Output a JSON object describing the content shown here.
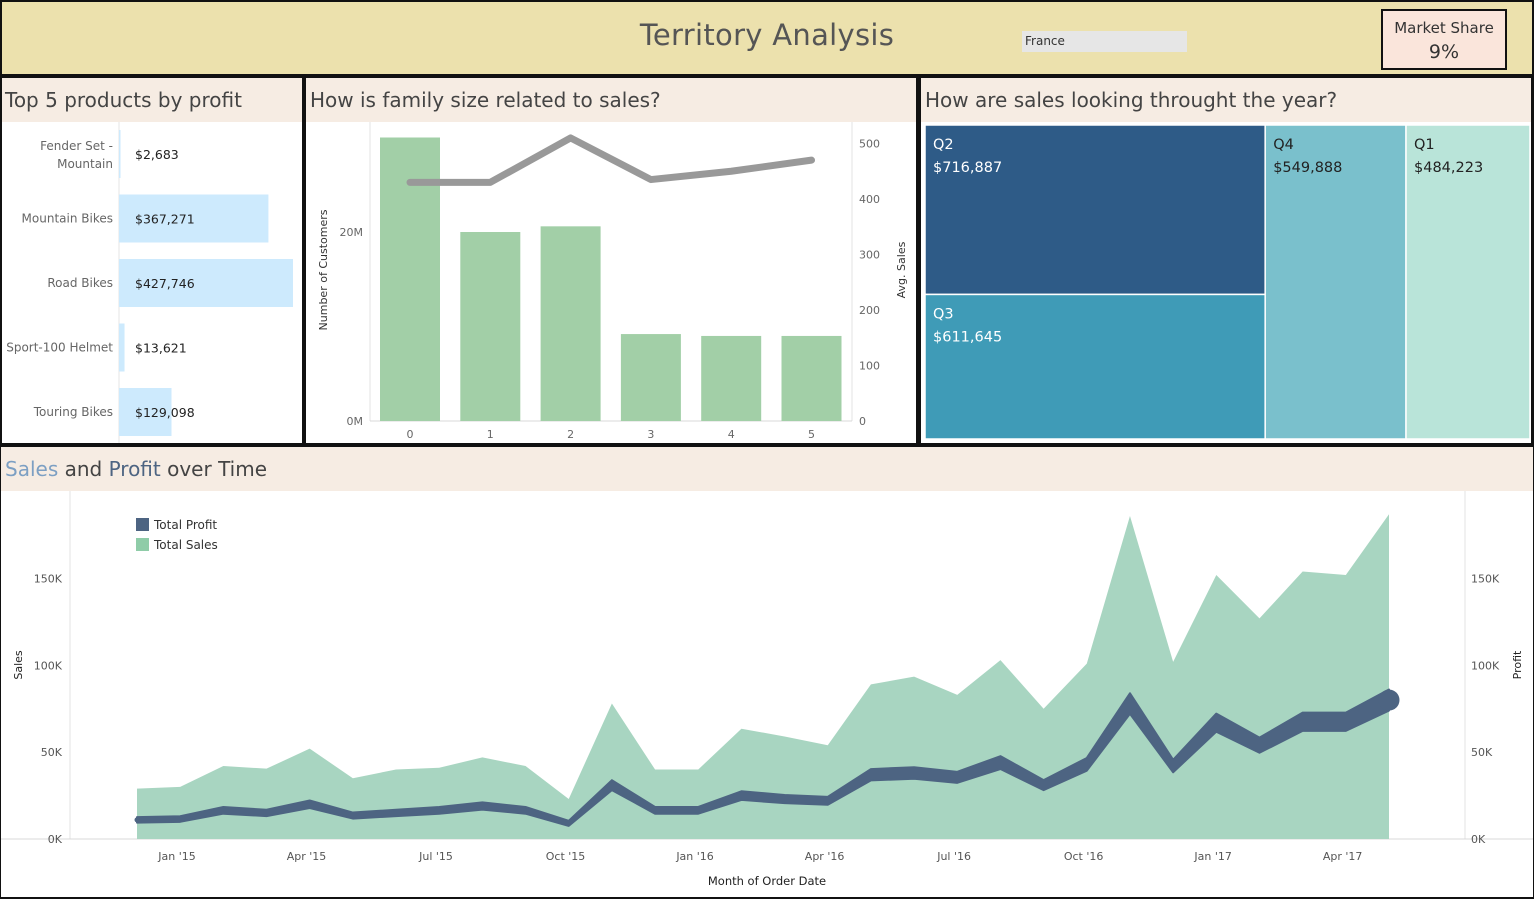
{
  "header": {
    "title": "Territory Analysis",
    "filter_value": "France",
    "market_share_label": "Market Share",
    "market_share_value": "9%"
  },
  "colors": {
    "header_bg": "#ece1ad",
    "panel_title_bg": "#f6ece3",
    "market_card_bg": "#fae5db",
    "bar_light_blue": "#cdeafd",
    "bar_green": "#a2cfa7",
    "line_gray": "#999999",
    "area_green": "#a8d5c1",
    "profit_navy": "#4d6482",
    "sales_word": "#7c9fc3",
    "q2": "#2e5b87",
    "q3": "#3f9bb7",
    "q4": "#7ac0cc",
    "q1": "#b9e4d9"
  },
  "chart_data": [
    {
      "id": "top5",
      "type": "bar",
      "orientation": "horizontal",
      "title": "Top 5 products by profit",
      "categories": [
        "Fender Set - Mountain",
        "Mountain Bikes",
        "Road Bikes",
        "Sport-100 Helmet",
        "Touring Bikes"
      ],
      "category_lines": [
        [
          "Fender Set -",
          "Mountain"
        ],
        [
          "Mountain Bikes"
        ],
        [
          "Road Bikes"
        ],
        [
          "Sport-100 Helmet"
        ],
        [
          "Touring Bikes"
        ]
      ],
      "values": [
        2683,
        367271,
        427746,
        13621,
        129098
      ],
      "labels": [
        "$2,683",
        "$367,271",
        "$427,746",
        "$13,621",
        "$129,098"
      ],
      "xlim": [
        0,
        440000
      ]
    },
    {
      "id": "family",
      "type": "bar",
      "title": "How is family size related to sales?",
      "categories": [
        "0",
        "1",
        "2",
        "3",
        "4",
        "5"
      ],
      "series": [
        {
          "name": "Number of Customers",
          "type": "bar",
          "values": [
            30000000,
            20000000,
            20600000,
            9200000,
            9000000,
            9000000
          ]
        },
        {
          "name": "Avg. Sales",
          "type": "line",
          "values": [
            430,
            430,
            510,
            435,
            450,
            470
          ]
        }
      ],
      "ylabel": "Number of Customers",
      "y2label": "Avg. Sales",
      "yticks": [
        {
          "v": 0,
          "l": "0M"
        },
        {
          "v": 20000000,
          "l": "20M"
        }
      ],
      "y2ticks": [
        {
          "v": 0,
          "l": "0"
        },
        {
          "v": 100,
          "l": "100"
        },
        {
          "v": 200,
          "l": "200"
        },
        {
          "v": 300,
          "l": "300"
        },
        {
          "v": 400,
          "l": "400"
        },
        {
          "v": 500,
          "l": "500"
        }
      ],
      "ylim": [
        0,
        31500000
      ],
      "y2lim": [
        0,
        545
      ]
    },
    {
      "id": "quarters",
      "type": "treemap",
      "title": "How are sales looking throught the year?",
      "items": [
        {
          "name": "Q2",
          "label": "$716,887",
          "value": 716887
        },
        {
          "name": "Q3",
          "label": "$611,645",
          "value": 611645
        },
        {
          "name": "Q4",
          "label": "$549,888",
          "value": 549888
        },
        {
          "name": "Q1",
          "label": "$484,223",
          "value": 484223
        }
      ]
    },
    {
      "id": "timeline",
      "type": "area",
      "title_parts": [
        "Sales",
        " and ",
        "Profit",
        " over Time"
      ],
      "xlabel": "Month of Order Date",
      "ylabel": "Sales",
      "y2label": "Profit",
      "x": [
        "Jan '15",
        "Feb '15",
        "Mar '15",
        "Apr '15",
        "May '15",
        "Jun '15",
        "Jul '15",
        "Aug '15",
        "Sep '15",
        "Oct '15",
        "Nov '15",
        "Dec '15",
        "Jan '16",
        "Feb '16",
        "Mar '16",
        "Apr '16",
        "May '16",
        "Jun '16",
        "Jul '16",
        "Aug '16",
        "Sep '16",
        "Oct '16",
        "Nov '16",
        "Dec '16",
        "Jan '17",
        "Feb '17",
        "Mar '17",
        "Apr '17",
        "May '17",
        "Jun '17"
      ],
      "xticks": [
        "Jan '15",
        "Apr '15",
        "Jul '15",
        "Oct '15",
        "Jan '16",
        "Apr '16",
        "Jul '16",
        "Oct '16",
        "Jan '17",
        "Apr '17"
      ],
      "series": [
        {
          "name": "Total Sales",
          "type": "area",
          "values": [
            29000,
            30000,
            42000,
            40500,
            52000,
            35000,
            40000,
            41000,
            47000,
            42000,
            23000,
            78000,
            40000,
            40000,
            63500,
            59000,
            54000,
            89000,
            93500,
            83000,
            103000,
            75000,
            101000,
            186000,
            102000,
            152000,
            127000,
            154000,
            152000,
            187000
          ]
        },
        {
          "name": "Total Profit",
          "type": "line",
          "values": [
            11000,
            11500,
            16500,
            15000,
            20000,
            13500,
            15000,
            16500,
            19000,
            16500,
            9000,
            31000,
            16500,
            16500,
            25000,
            23000,
            22000,
            37000,
            38000,
            35500,
            44000,
            31000,
            43000,
            78000,
            42000,
            67000,
            54000,
            67500,
            67500,
            80000
          ]
        }
      ],
      "yticks": [
        "0K",
        "50K",
        "100K",
        "150K"
      ],
      "ytick_values": [
        0,
        50000,
        100000,
        150000
      ],
      "ylim": [
        0,
        190000
      ],
      "legend": "top-left"
    }
  ]
}
